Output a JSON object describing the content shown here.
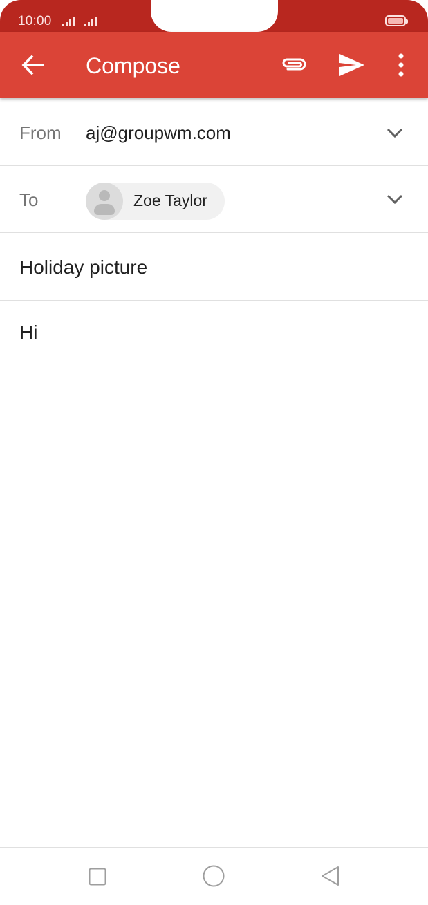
{
  "status_bar": {
    "time": "10:00",
    "icons": [
      "signal-icon",
      "signal-icon",
      "battery-icon"
    ]
  },
  "app_bar": {
    "title": "Compose",
    "icons": [
      "back-arrow-icon",
      "attach-icon",
      "send-icon",
      "more-vert-icon"
    ],
    "color": "#db4437"
  },
  "compose": {
    "from_label": "From",
    "from_value": "aj@groupwm.com",
    "to_label": "To",
    "to_recipient": "Zoe Taylor",
    "subject": "Holiday picture",
    "body": "Hi"
  },
  "nav_bar": {
    "icons": [
      "recents-square-icon",
      "home-circle-icon",
      "back-triangle-icon"
    ]
  }
}
